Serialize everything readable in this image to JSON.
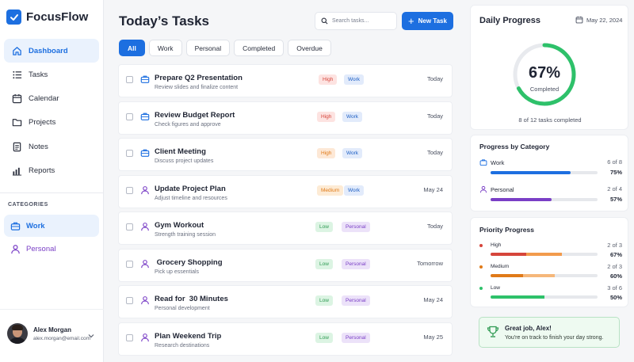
{
  "app": {
    "name": "FocusFlow"
  },
  "sidebar": {
    "nav": [
      {
        "label": "Dashboard",
        "icon": "home-icon",
        "active": true
      },
      {
        "label": "Tasks",
        "icon": "list-icon"
      },
      {
        "label": "Calendar",
        "icon": "calendar-icon"
      },
      {
        "label": "Projects",
        "icon": "folder-icon"
      },
      {
        "label": "Notes",
        "icon": "note-icon"
      },
      {
        "label": "Reports",
        "icon": "bar-chart-icon"
      }
    ],
    "categories_heading": "CATEGORIES",
    "categories": [
      {
        "label": "Work",
        "icon": "briefcase-icon"
      },
      {
        "label": "Personal",
        "icon": "person-icon"
      }
    ],
    "user": {
      "name": "Alex Morgan",
      "email": "alex.morgan@email.com"
    }
  },
  "main": {
    "title": "Today’s Tasks",
    "search_placeholder": "Search tasks...",
    "new_task_label": "New Task",
    "filters": [
      "All",
      "Work",
      "Personal",
      "Completed",
      "Overdue"
    ],
    "tasks": [
      {
        "title": "Prepare Q2 Presentation",
        "subtitle": "Review slides and finalize content",
        "priority": "High",
        "category": "Work",
        "date": "Today",
        "icon": "briefcase-icon"
      },
      {
        "title": "Review Budget Report",
        "subtitle": "Check figures and approve",
        "priority": "High",
        "category": "Work",
        "date": "Today",
        "icon": "briefcase-icon"
      },
      {
        "title": "Client Meeting",
        "subtitle": "Discuss project updates",
        "priority": "High",
        "category": "Work",
        "date": "Today",
        "icon": "briefcase-icon"
      },
      {
        "title": "Update Project Plan",
        "subtitle": "Adjust timeline and resources",
        "priority": "Medium",
        "category": "Work",
        "date": "May 24",
        "icon": "person-icon"
      },
      {
        "title": "Gym Workout",
        "subtitle": "Strength training session",
        "priority": "Low",
        "category": "Personal",
        "date": "Today",
        "icon": "person-icon"
      },
      {
        "title": " Grocery Shopping",
        "subtitle": " Pick up essentials",
        "priority": "Low",
        "category": "Personal",
        "date": "Tomorrow",
        "icon": "person-icon"
      },
      {
        "title": "Read for  30 Minutes",
        "subtitle": "Personal development",
        "priority": "Low",
        "category": "Personal",
        "date": "May 24",
        "icon": "person-icon"
      },
      {
        "title": "Plan Weekend Trip",
        "subtitle": "Research destinations",
        "priority": "Low",
        "category": "Personal",
        "date": "May 25",
        "icon": "person-icon"
      }
    ]
  },
  "daily_progress": {
    "title": "Daily Progress",
    "date": "May 22, 2024",
    "percent_label": "67%",
    "percent": 0.67,
    "status": "Completed",
    "summary": "8 of 12 tasks completed"
  },
  "progress_by_category": {
    "title": "Progress by Category",
    "rows": [
      {
        "name": "Work",
        "count": "6 of 8",
        "percent_label": "75%",
        "percent": 0.75,
        "color": "#1d6fe0",
        "icon": "briefcase-icon"
      },
      {
        "name": "Personal",
        "count": "2 of 4",
        "percent_label": "57%",
        "percent": 0.57,
        "color": "#7a3fc6",
        "icon": "person-icon"
      }
    ]
  },
  "priority_progress": {
    "title": "Priority Progress",
    "rows": [
      {
        "name": "High",
        "count": "2 of 3",
        "percent_label": "67%",
        "percent": 0.67,
        "colors": [
          "#d6453b",
          "#f29b4c"
        ]
      },
      {
        "name": "Medium",
        "count": "2 of 3",
        "percent_label": "60%",
        "percent": 0.6,
        "colors": [
          "#e07a18",
          "#f5b77a"
        ]
      },
      {
        "name": "Low",
        "count": "3 of 6",
        "percent_label": "50%",
        "percent": 0.5,
        "colors": [
          "#2ec16a",
          "#2ec16a"
        ]
      }
    ]
  },
  "congrats": {
    "title": "Great job, Alex!",
    "message": "You're on track to finish your day strong."
  },
  "colors": {
    "accent": "#1d6fe0",
    "personal": "#7a3fc6",
    "success": "#2ec16a"
  }
}
